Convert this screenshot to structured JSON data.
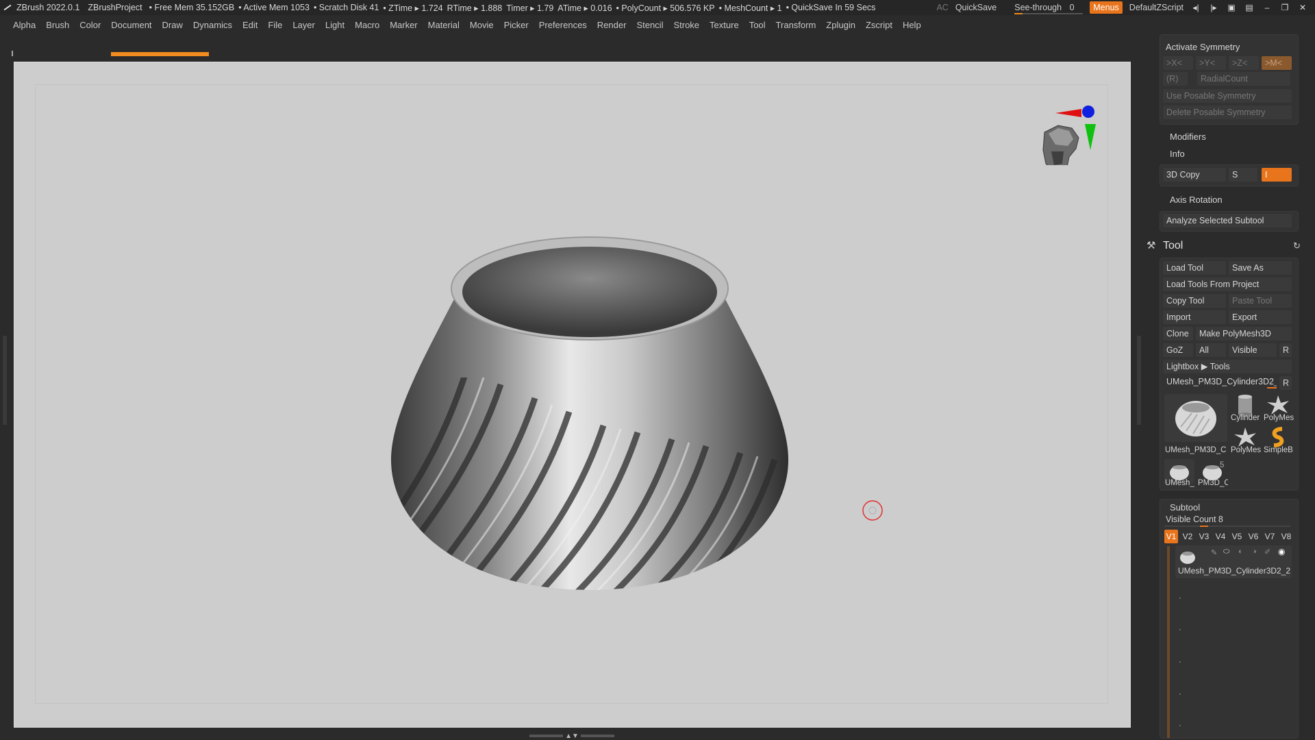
{
  "titlebar": {
    "app": "ZBrush 2022.0.1",
    "project": "ZBrushProject",
    "free_mem": "• Free Mem 35.152GB",
    "active_mem": "• Active Mem 1053",
    "scratch": "• Scratch Disk 41",
    "ztime": "• ZTime ▸ 1.724",
    "rtime": "RTime ▸ 1.888",
    "timer": "Timer ▸ 1.79",
    "atime": "ATime ▸ 0.016",
    "polycount": "• PolyCount ▸ 506.576 KP",
    "meshcount": "• MeshCount ▸ 1",
    "quicksave_in": "• QuickSave In 59 Secs",
    "ac": "AC",
    "quicksave": "QuickSave",
    "see_through_label": "See-through",
    "see_through_value": "0",
    "see_through_level": 0.12,
    "menus": "Menus",
    "script": "DefaultZScript"
  },
  "menubar": [
    "Alpha",
    "Brush",
    "Color",
    "Document",
    "Draw",
    "Dynamics",
    "Edit",
    "File",
    "Layer",
    "Light",
    "Macro",
    "Marker",
    "Material",
    "Movie",
    "Picker",
    "Preferences",
    "Render",
    "Stencil",
    "Stroke",
    "Texture",
    "Tool",
    "Transform",
    "Zplugin",
    "Zscript",
    "Help"
  ],
  "colors": {
    "accent": "#e8741c",
    "viewport_bg": "#cdcdcd",
    "panel_bg": "#2b2b2b"
  },
  "symmetry": {
    "title": "Activate Symmetry",
    "x": ">X<",
    "y": ">Y<",
    "z": ">Z<",
    "m": ">M<",
    "r": "(R)",
    "radial": "RadialCount",
    "use_posable": "Use Posable Symmetry",
    "delete_posable": "Delete Posable Symmetry"
  },
  "modifiers": "Modifiers",
  "info": "Info",
  "copy3d": {
    "label": "3D Copy",
    "s": "S",
    "i": "I"
  },
  "axis_rotation": "Axis Rotation",
  "analyze": "Analyze Selected Subtool",
  "tool": {
    "title": "Tool",
    "load_tool": "Load Tool",
    "save_as": "Save As",
    "load_from_project": "Load Tools From Project",
    "copy_tool": "Copy Tool",
    "paste_tool": "Paste Tool",
    "import": "Import",
    "export": "Export",
    "clone": "Clone",
    "make_polymesh": "Make PolyMesh3D",
    "goz": "GoZ",
    "all": "All",
    "visible": "Visible",
    "r": "R",
    "lightbox": "Lightbox ▶ Tools",
    "current": "UMesh_PM3D_Cylinder3D2_2",
    "thumbs": [
      {
        "name": "UMesh_PM3D_C",
        "icon": "vase-icon"
      },
      {
        "name": "Cylinder",
        "icon": "cylinder-icon"
      },
      {
        "name": "PolyMes",
        "icon": "star-icon"
      },
      {
        "name": "PolyMes",
        "icon": "star-icon"
      },
      {
        "name": "SimpleB",
        "icon": "simplebrush-icon"
      },
      {
        "name": "UMesh_",
        "icon": "vase-icon"
      },
      {
        "name": "PM3D_C",
        "icon": "vase-icon"
      }
    ],
    "thumb_badge": "5"
  },
  "subtool": {
    "title": "Subtool",
    "visible_count": "Visible Count 8",
    "tabs": [
      "V1",
      "V2",
      "V3",
      "V4",
      "V5",
      "V6",
      "V7",
      "V8"
    ],
    "active_tab": "V1",
    "item_name": "UMesh_PM3D_Cylinder3D2_2"
  }
}
